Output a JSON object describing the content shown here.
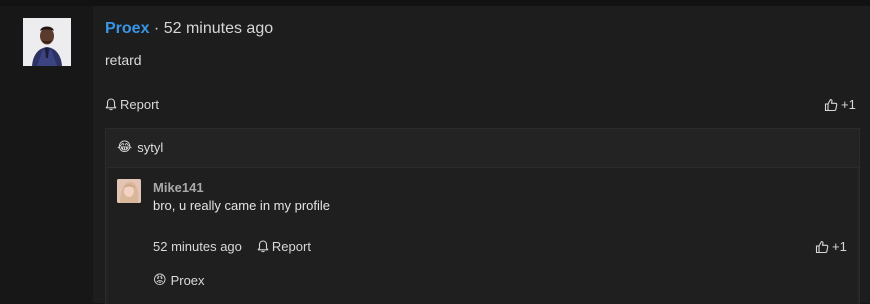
{
  "comment": {
    "author": "Proex",
    "separator": "·",
    "time": "52 minutes ago",
    "text": "retard",
    "report_label": "Report",
    "vote_label": "+1"
  },
  "replies_section": {
    "reaction": {
      "emoji": "😂",
      "user": "sytyl"
    },
    "reply": {
      "author": "Mike141",
      "text": "bro, u really came in my profile",
      "time": "52 minutes ago",
      "report_label": "Report",
      "vote_label": "+1",
      "reaction": {
        "emoji": "😡",
        "user": "Proex"
      }
    }
  },
  "colors": {
    "author_link": "#3796ea",
    "background": "#161616",
    "panel": "#1d1d1d",
    "reply_box": "#232323"
  },
  "icons": {
    "report": "bell-icon",
    "vote": "thumbs-up-icon"
  }
}
